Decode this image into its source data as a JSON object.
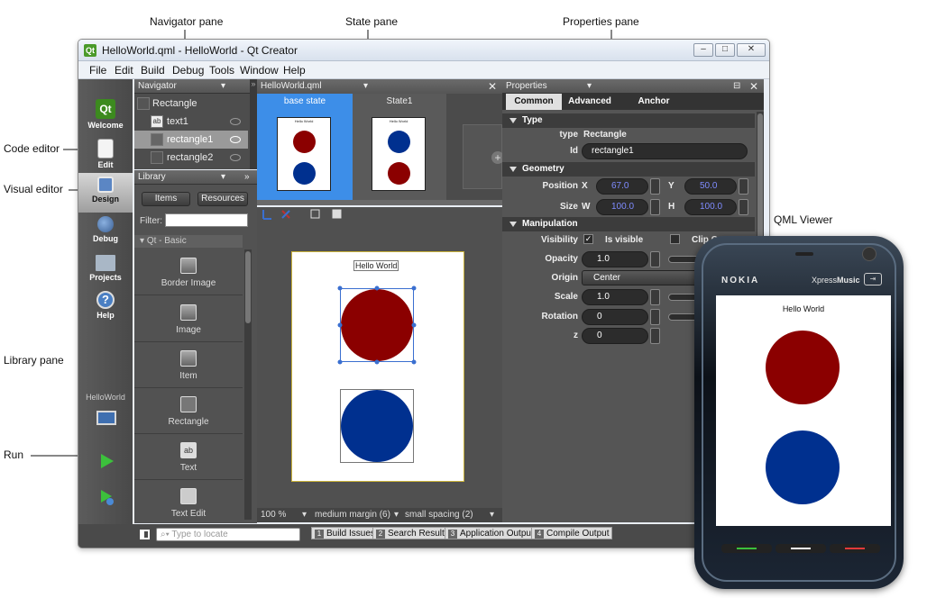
{
  "annotations": {
    "navigator": "Navigator pane",
    "state": "State pane",
    "properties": "Properties pane",
    "code_editor": "Code editor",
    "visual_editor": "Visual editor",
    "library": "Library pane",
    "run": "Run",
    "qml_viewer": "QML Viewer"
  },
  "window": {
    "title": "HelloWorld.qml - HelloWorld - Qt Creator",
    "app_icon": "Qt"
  },
  "menu": [
    "File",
    "Edit",
    "Build",
    "Debug",
    "Tools",
    "Window",
    "Help"
  ],
  "modes": {
    "welcome": "Welcome",
    "edit": "Edit",
    "design": "Design",
    "debug": "Debug",
    "projects": "Projects",
    "help": "Help",
    "project": "HelloWorld",
    "qt_logo": "Qt",
    "help_glyph": "?"
  },
  "navigator": {
    "title": "Navigator",
    "root": "Rectangle",
    "items": [
      "text1",
      "rectangle1",
      "rectangle2"
    ]
  },
  "library": {
    "title": "Library",
    "tab_items": "Items",
    "tab_resources": "Resources",
    "filter_label": "Filter:",
    "group": "Qt - Basic",
    "items": [
      "Border Image",
      "Image",
      "Item",
      "Rectangle",
      "Text",
      "Text Edit"
    ],
    "text_glyph": "ab"
  },
  "editor": {
    "file": "HelloWorld.qml",
    "zoom": "100 %",
    "margin": "medium margin (6)",
    "spacing": "small spacing (2)"
  },
  "states": {
    "base": "base state",
    "state1": "State1",
    "thumb_text": "Hello World",
    "add": "+"
  },
  "canvas": {
    "text": "Hello World"
  },
  "properties": {
    "title": "Properties",
    "tabs": [
      "Common",
      "Advanced",
      "Anchor"
    ],
    "type_section": "Type",
    "type_label": "type",
    "type_value": "Rectangle",
    "id_label": "Id",
    "id_value": "rectangle1",
    "geometry_section": "Geometry",
    "position_label": "Position",
    "size_label": "Size",
    "x_label": "X",
    "x_value": "67.0",
    "y_label": "Y",
    "y_value": "50.0",
    "w_label": "W",
    "w_value": "100.0",
    "h_label": "H",
    "h_value": "100.0",
    "manipulation_section": "Manipulation",
    "visibility_label": "Visibility",
    "visible_text": "Is visible",
    "clip_text": "Clip C",
    "opacity_label": "Opacity",
    "opacity_value": "1.0",
    "origin_label": "Origin",
    "origin_value": "Center",
    "scale_label": "Scale",
    "scale_value": "1.0",
    "rotation_label": "Rotation",
    "rotation_value": "0",
    "z_label": "z",
    "z_value": "0"
  },
  "statusbar": {
    "locate_placeholder": "Type to locate",
    "outputs": [
      {
        "n": "1",
        "label": "Build Issues"
      },
      {
        "n": "2",
        "label": "Search Results"
      },
      {
        "n": "3",
        "label": "Application Output"
      },
      {
        "n": "4",
        "label": "Compile Output"
      }
    ]
  },
  "phone": {
    "brand": "NOKIA",
    "model_a": "Xpress",
    "model_b": "Music",
    "screen_text": "Hello World"
  },
  "colors": {
    "red": "#8b0000",
    "blue": "#00308f",
    "selection": "#4d8fe8",
    "accent": "#ffd200"
  }
}
